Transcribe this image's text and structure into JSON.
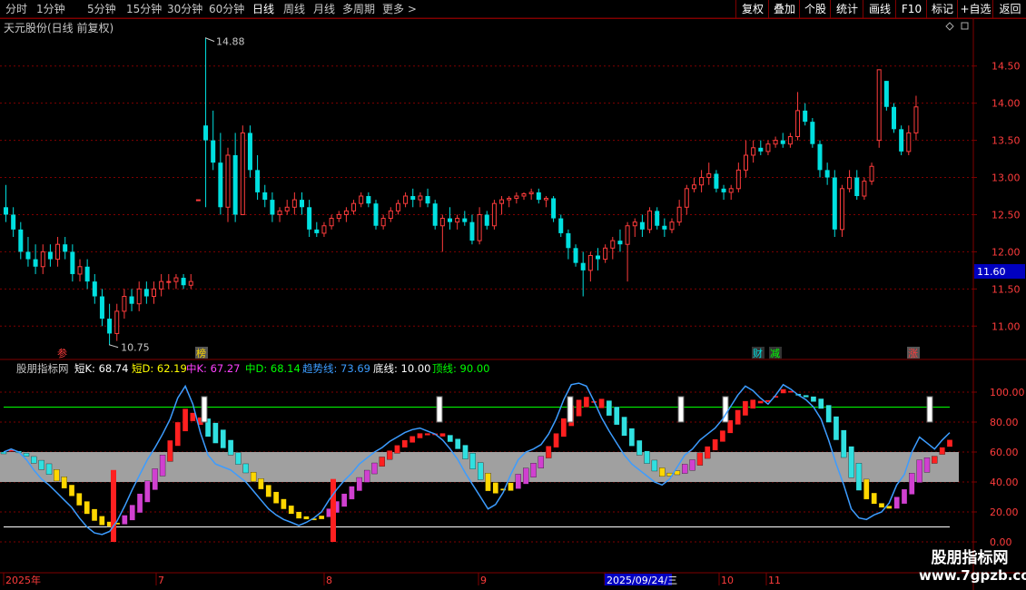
{
  "toolbar": {
    "periods": [
      "分时",
      "1分钟",
      "5分钟",
      "15分钟",
      "30分钟",
      "60分钟",
      "日线",
      "周线",
      "月线",
      "多周期",
      "更多 >"
    ],
    "active_period": "日线",
    "right_buttons": [
      "复权",
      "叠加",
      "个股",
      "统计",
      "画线",
      "F10",
      "标记",
      "+自选",
      "返回"
    ]
  },
  "stock_title": "天元股份(日线 前复权)",
  "price_panel": {
    "y_ticks": [
      "14.50",
      "14.00",
      "13.50",
      "13.00",
      "12.50",
      "12.00",
      "11.50",
      "11.00"
    ],
    "current_price": "11.60",
    "high_label": "14.88",
    "low_label": "10.75",
    "event_markers": [
      "参",
      "榜",
      "财",
      "减",
      "涨"
    ]
  },
  "indicator_panel": {
    "name": "股朋指标网",
    "legend": [
      {
        "label": "短K: 68.74",
        "color": "#ffffff"
      },
      {
        "label": "短D: 62.19",
        "color": "#ffff00"
      },
      {
        "label": "中K: 67.27",
        "color": "#ff40ff"
      },
      {
        "label": "中D: 68.14",
        "color": "#00ff00"
      },
      {
        "label": "趋势线: 73.69",
        "color": "#3c9cff"
      },
      {
        "label": "底线: 10.00",
        "color": "#ffffff"
      },
      {
        "label": "顶线: 90.00",
        "color": "#00ff00"
      }
    ],
    "y_ticks": [
      "100.00",
      "80.00",
      "60.00",
      "40.00",
      "20.00",
      "0.00"
    ]
  },
  "date_axis": [
    "2025年",
    "7",
    "8",
    "9",
    "2025/09/24/三",
    "10",
    "11"
  ],
  "watermark": {
    "line1": "股朋指标网",
    "line2": "www.7gpzb.com"
  },
  "colors": {
    "up": "#ff3c3c",
    "down": "#00e0e0",
    "grid": "#800000",
    "axis_text": "#ff3c3c"
  },
  "chart_data": [
    {
      "type": "candlestick",
      "title": "天元股份(日线 前复权)",
      "ylim": [
        10.6,
        15.0
      ],
      "ohlc": [
        [
          12.6,
          12.9,
          12.4,
          12.5
        ],
        [
          12.5,
          12.6,
          12.2,
          12.3
        ],
        [
          12.3,
          12.4,
          11.9,
          12.0
        ],
        [
          12.0,
          12.2,
          11.8,
          11.9
        ],
        [
          11.9,
          12.1,
          11.7,
          11.8
        ],
        [
          11.8,
          12.1,
          11.7,
          12.0
        ],
        [
          12.0,
          12.1,
          11.8,
          11.9
        ],
        [
          11.9,
          12.2,
          11.8,
          12.1
        ],
        [
          12.1,
          12.2,
          11.9,
          12.0
        ],
        [
          12.0,
          12.1,
          11.6,
          11.7
        ],
        [
          11.7,
          11.9,
          11.6,
          11.8
        ],
        [
          11.8,
          11.9,
          11.5,
          11.6
        ],
        [
          11.6,
          11.7,
          11.3,
          11.4
        ],
        [
          11.4,
          11.5,
          11.0,
          11.1
        ],
        [
          11.1,
          11.3,
          10.75,
          10.9
        ],
        [
          10.9,
          11.3,
          10.8,
          11.2
        ],
        [
          11.2,
          11.5,
          11.1,
          11.4
        ],
        [
          11.4,
          11.5,
          11.2,
          11.3
        ],
        [
          11.3,
          11.6,
          11.2,
          11.5
        ],
        [
          11.5,
          11.6,
          11.3,
          11.4
        ],
        [
          11.4,
          11.6,
          11.3,
          11.5
        ],
        [
          11.5,
          11.7,
          11.4,
          11.6
        ],
        [
          11.6,
          11.7,
          11.5,
          11.6
        ],
        [
          11.6,
          11.7,
          11.5,
          11.65
        ],
        [
          11.65,
          11.7,
          11.5,
          11.55
        ],
        [
          11.55,
          11.7,
          11.5,
          11.6
        ],
        [
          12.7,
          12.7,
          12.7,
          12.7
        ],
        [
          13.7,
          14.88,
          12.6,
          13.5
        ],
        [
          13.5,
          13.9,
          13.1,
          13.2
        ],
        [
          13.2,
          13.6,
          12.5,
          12.6
        ],
        [
          12.6,
          13.4,
          12.4,
          13.3
        ],
        [
          13.3,
          13.6,
          12.4,
          12.5
        ],
        [
          12.5,
          13.7,
          12.5,
          13.6
        ],
        [
          13.6,
          13.7,
          13.0,
          13.1
        ],
        [
          13.1,
          13.3,
          12.7,
          12.8
        ],
        [
          12.8,
          12.9,
          12.6,
          12.7
        ],
        [
          12.7,
          12.8,
          12.4,
          12.5
        ],
        [
          12.5,
          12.6,
          12.4,
          12.55
        ],
        [
          12.55,
          12.7,
          12.5,
          12.6
        ],
        [
          12.6,
          12.8,
          12.5,
          12.7
        ],
        [
          12.7,
          12.8,
          12.5,
          12.6
        ],
        [
          12.6,
          12.7,
          12.2,
          12.3
        ],
        [
          12.3,
          12.4,
          12.2,
          12.25
        ],
        [
          12.25,
          12.4,
          12.2,
          12.35
        ],
        [
          12.35,
          12.5,
          12.3,
          12.45
        ],
        [
          12.45,
          12.55,
          12.4,
          12.5
        ],
        [
          12.5,
          12.6,
          12.4,
          12.55
        ],
        [
          12.55,
          12.7,
          12.5,
          12.65
        ],
        [
          12.65,
          12.8,
          12.6,
          12.75
        ],
        [
          12.75,
          12.8,
          12.6,
          12.65
        ],
        [
          12.65,
          12.7,
          12.3,
          12.35
        ],
        [
          12.35,
          12.5,
          12.3,
          12.45
        ],
        [
          12.45,
          12.6,
          12.4,
          12.55
        ],
        [
          12.55,
          12.7,
          12.5,
          12.65
        ],
        [
          12.65,
          12.8,
          12.6,
          12.75
        ],
        [
          12.75,
          12.85,
          12.6,
          12.7
        ],
        [
          12.7,
          12.8,
          12.6,
          12.75
        ],
        [
          12.75,
          12.85,
          12.6,
          12.65
        ],
        [
          12.65,
          12.7,
          12.3,
          12.35
        ],
        [
          12.35,
          12.5,
          12.0,
          12.45
        ],
        [
          12.45,
          12.6,
          12.3,
          12.4
        ],
        [
          12.4,
          12.5,
          12.3,
          12.45
        ],
        [
          12.45,
          12.55,
          12.35,
          12.4
        ],
        [
          12.4,
          12.5,
          12.1,
          12.15
        ],
        [
          12.15,
          12.6,
          12.1,
          12.5
        ],
        [
          12.5,
          12.55,
          12.3,
          12.35
        ],
        [
          12.35,
          12.7,
          12.3,
          12.65
        ],
        [
          12.65,
          12.75,
          12.5,
          12.7
        ],
        [
          12.7,
          12.75,
          12.6,
          12.72
        ],
        [
          12.72,
          12.8,
          12.65,
          12.75
        ],
        [
          12.75,
          12.8,
          12.7,
          12.78
        ],
        [
          12.78,
          12.85,
          12.7,
          12.8
        ],
        [
          12.8,
          12.85,
          12.65,
          12.7
        ],
        [
          12.7,
          12.75,
          12.6,
          12.72
        ],
        [
          12.72,
          12.75,
          12.4,
          12.45
        ],
        [
          12.45,
          12.5,
          12.2,
          12.25
        ],
        [
          12.25,
          12.3,
          11.9,
          12.05
        ],
        [
          12.05,
          12.1,
          11.8,
          11.85
        ],
        [
          11.85,
          12.0,
          11.4,
          11.75
        ],
        [
          11.75,
          12.0,
          11.6,
          11.95
        ],
        [
          11.95,
          12.05,
          11.75,
          11.9
        ],
        [
          11.9,
          12.1,
          11.85,
          12.05
        ],
        [
          12.05,
          12.2,
          11.9,
          12.15
        ],
        [
          12.15,
          12.3,
          12.0,
          12.1
        ],
        [
          12.1,
          12.4,
          11.6,
          12.35
        ],
        [
          12.35,
          12.45,
          12.2,
          12.4
        ],
        [
          12.4,
          12.5,
          12.2,
          12.3
        ],
        [
          12.3,
          12.6,
          12.25,
          12.55
        ],
        [
          12.55,
          12.6,
          12.3,
          12.35
        ],
        [
          12.35,
          12.45,
          12.2,
          12.3
        ],
        [
          12.3,
          12.45,
          12.25,
          12.4
        ],
        [
          12.4,
          12.7,
          12.35,
          12.6
        ],
        [
          12.6,
          12.9,
          12.5,
          12.85
        ],
        [
          12.85,
          13.0,
          12.8,
          12.9
        ],
        [
          12.9,
          13.1,
          12.8,
          13.0
        ],
        [
          13.0,
          13.2,
          12.9,
          13.05
        ],
        [
          13.05,
          13.1,
          12.8,
          12.85
        ],
        [
          12.85,
          12.9,
          12.7,
          12.8
        ],
        [
          12.8,
          12.9,
          12.7,
          12.85
        ],
        [
          12.85,
          13.2,
          12.8,
          13.1
        ],
        [
          13.1,
          13.5,
          13.0,
          13.3
        ],
        [
          13.3,
          13.5,
          13.2,
          13.4
        ],
        [
          13.4,
          13.5,
          13.3,
          13.35
        ],
        [
          13.35,
          13.5,
          13.3,
          13.45
        ],
        [
          13.45,
          13.55,
          13.4,
          13.5
        ],
        [
          13.5,
          13.6,
          13.4,
          13.45
        ],
        [
          13.45,
          13.6,
          13.4,
          13.55
        ],
        [
          13.55,
          14.15,
          13.5,
          13.9
        ],
        [
          13.9,
          14.0,
          13.7,
          13.75
        ],
        [
          13.75,
          13.8,
          13.4,
          13.45
        ],
        [
          13.45,
          13.5,
          13.0,
          13.1
        ],
        [
          13.1,
          13.2,
          12.9,
          13.0
        ],
        [
          13.0,
          13.1,
          12.2,
          12.3
        ],
        [
          12.3,
          12.9,
          12.2,
          12.85
        ],
        [
          12.85,
          13.1,
          12.8,
          13.0
        ],
        [
          13.0,
          13.1,
          12.7,
          12.75
        ],
        [
          12.75,
          13.0,
          12.7,
          12.95
        ],
        [
          12.95,
          13.2,
          12.9,
          13.15
        ],
        [
          13.5,
          14.45,
          13.4,
          14.45
        ],
        [
          14.3,
          14.3,
          13.9,
          13.95
        ],
        [
          13.95,
          14.0,
          13.6,
          13.65
        ],
        [
          13.65,
          13.7,
          13.3,
          13.35
        ],
        [
          13.35,
          13.7,
          13.3,
          13.6
        ],
        [
          13.6,
          14.1,
          13.5,
          13.95
        ]
      ]
    },
    {
      "type": "line",
      "title": "股朋指标网",
      "ylim": [
        0,
        110
      ],
      "series": [
        {
          "name": "趋势线",
          "values": [
            60,
            62,
            60,
            55,
            48,
            42,
            38,
            33,
            28,
            23,
            16,
            10,
            6,
            5,
            7,
            14,
            24,
            35,
            45,
            55,
            63,
            72,
            82,
            96,
            104,
            92,
            73,
            58,
            52,
            50,
            48,
            44,
            40,
            34,
            28,
            22,
            18,
            15,
            13,
            11,
            13,
            16,
            20,
            28,
            35,
            41,
            46,
            52,
            56,
            60,
            63,
            67,
            70,
            73,
            75,
            76,
            74,
            72,
            68,
            62,
            55,
            46,
            38,
            30,
            22,
            25,
            33,
            45,
            55,
            60,
            62,
            65,
            72,
            82,
            95,
            105,
            106,
            104,
            94,
            83,
            74,
            66,
            58,
            52,
            48,
            44,
            40,
            38,
            42,
            50,
            58,
            62,
            68,
            72,
            76,
            82,
            90,
            98,
            104,
            101,
            96,
            92,
            98,
            105,
            102,
            98,
            95,
            90,
            82,
            68,
            52,
            38,
            22,
            16,
            15,
            18,
            20,
            26,
            38,
            45,
            60,
            70,
            66,
            62,
            68,
            73
          ]
        }
      ]
    }
  ]
}
